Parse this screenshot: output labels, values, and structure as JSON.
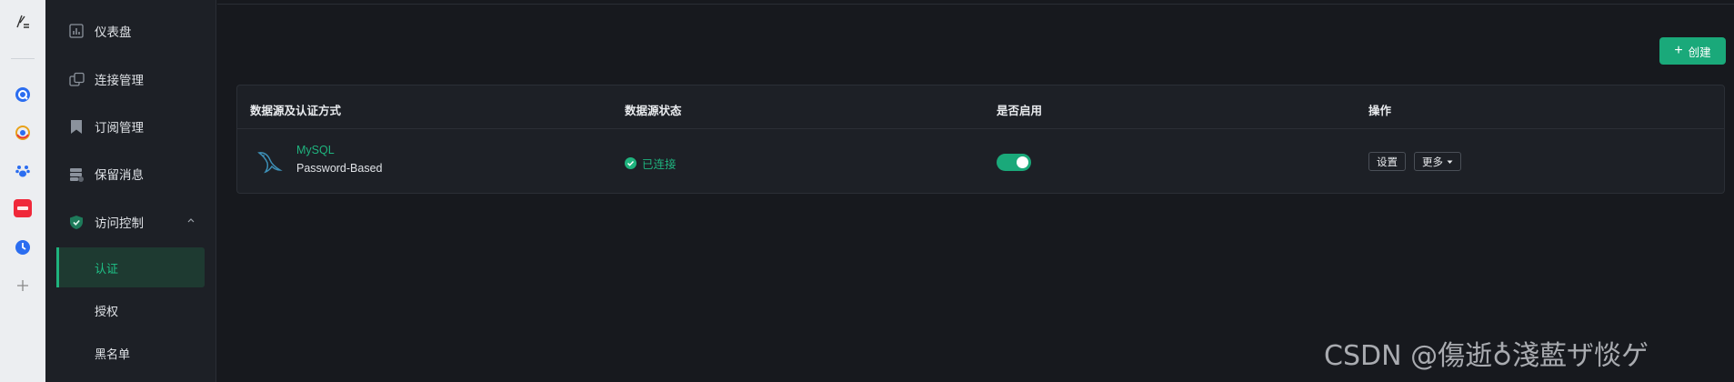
{
  "sidebar": {
    "items": [
      {
        "label": "仪表盘"
      },
      {
        "label": "连接管理"
      },
      {
        "label": "订阅管理"
      },
      {
        "label": "保留消息"
      },
      {
        "label": "访问控制"
      }
    ],
    "subitems": [
      {
        "label": "认证",
        "active": true
      },
      {
        "label": "授权"
      },
      {
        "label": "黑名单"
      }
    ]
  },
  "toolbar": {
    "create_label": "创建"
  },
  "table": {
    "headers": [
      "数据源及认证方式",
      "数据源状态",
      "是否启用",
      "操作"
    ],
    "rows": [
      {
        "name": "MySQL",
        "auth": "Password-Based",
        "status": "已连接",
        "enabled": true,
        "actions": {
          "settings": "设置",
          "more": "更多"
        }
      }
    ]
  },
  "watermark": "CSDN @傷逝♁淺藍ザ惔ゲ",
  "colors": {
    "accent": "#1aa97a",
    "background": "#17191e",
    "sidebar": "#1d2026"
  }
}
